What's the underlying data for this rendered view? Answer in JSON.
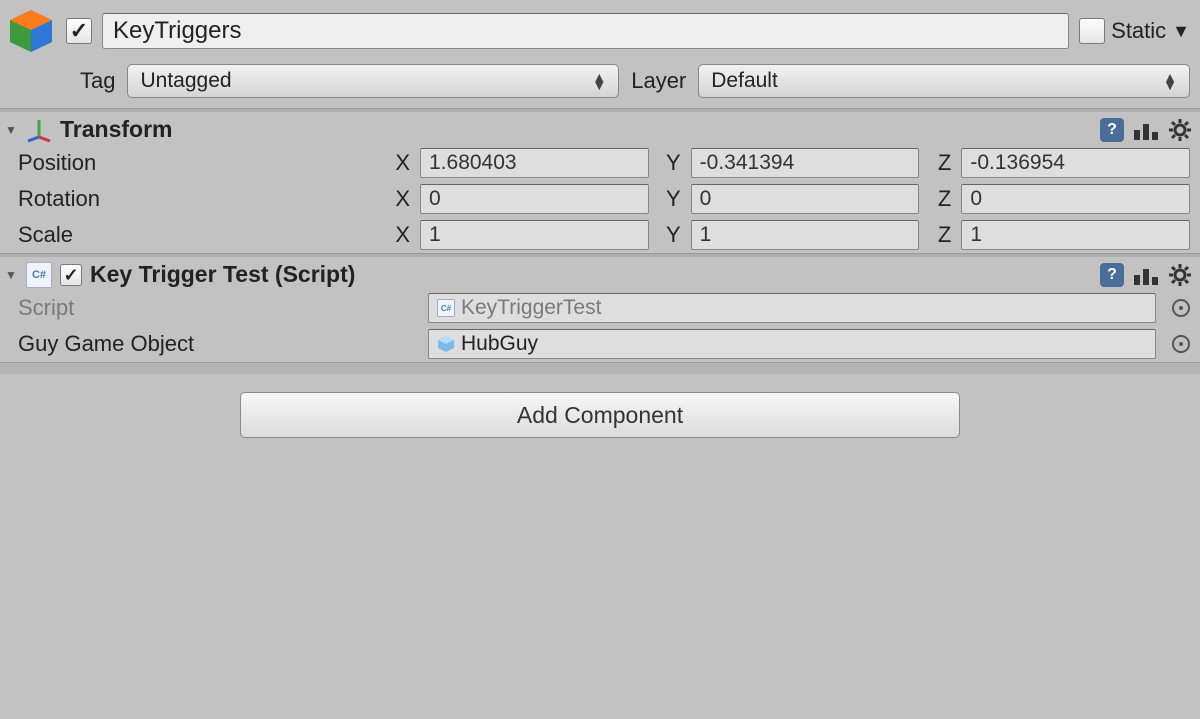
{
  "header": {
    "active": true,
    "name": "KeyTriggers",
    "static_label": "Static",
    "static_checked": false
  },
  "tag_row": {
    "tag_label": "Tag",
    "tag_value": "Untagged",
    "layer_label": "Layer",
    "layer_value": "Default"
  },
  "transform": {
    "title": "Transform",
    "position_label": "Position",
    "rotation_label": "Rotation",
    "scale_label": "Scale",
    "axis": {
      "x": "X",
      "y": "Y",
      "z": "Z"
    },
    "position": {
      "x": "1.680403",
      "y": "-0.341394",
      "z": "-0.136954"
    },
    "rotation": {
      "x": "0",
      "y": "0",
      "z": "0"
    },
    "scale": {
      "x": "1",
      "y": "1",
      "z": "1"
    }
  },
  "script_component": {
    "title": "Key Trigger Test (Script)",
    "enabled": true,
    "script_label": "Script",
    "script_value": "KeyTriggerTest",
    "guy_label": "Guy Game Object",
    "guy_value": "HubGuy"
  },
  "footer": {
    "add_component": "Add Component"
  }
}
